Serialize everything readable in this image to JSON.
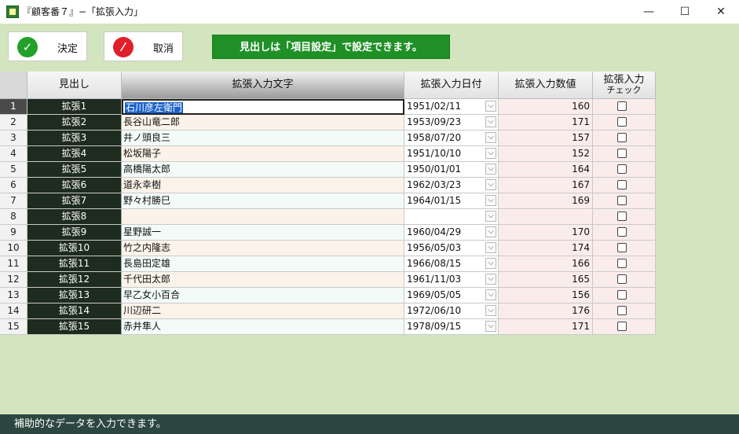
{
  "window": {
    "title": "『顧客番７』−「拡張入力」",
    "minimize_glyph": "—",
    "maximize_glyph": "☐",
    "close_glyph": "✕",
    "app_icon": "customer-app-icon"
  },
  "toolbar": {
    "ok_label": "決定",
    "ok_icon": "check-icon",
    "ok_color": "#21a12a",
    "cancel_label": "取消",
    "cancel_icon": "no-entry-icon",
    "cancel_color": "#e0202a",
    "banner_text": "見出しは「項目設定」で設定できます。",
    "banner_color": "#1f9026"
  },
  "grid": {
    "headers": {
      "label": "見出し",
      "text": "拡張入力文字",
      "date": "拡張入力日付",
      "number": "拡張入力数値",
      "check_line1": "拡張入力",
      "check_line2": "チェック"
    },
    "selected_row": 1,
    "rows": [
      {
        "no": "1",
        "label": "拡張1",
        "text": "石川彦左衛門",
        "date": "1951/02/11",
        "number": "160",
        "checked": false
      },
      {
        "no": "2",
        "label": "拡張2",
        "text": "長谷山竜二郎",
        "date": "1953/09/23",
        "number": "171",
        "checked": false
      },
      {
        "no": "3",
        "label": "拡張3",
        "text": "井ノ頭良三",
        "date": "1958/07/20",
        "number": "157",
        "checked": false
      },
      {
        "no": "4",
        "label": "拡張4",
        "text": "松坂陽子",
        "date": "1951/10/10",
        "number": "152",
        "checked": false
      },
      {
        "no": "5",
        "label": "拡張5",
        "text": "高橋陽太郎",
        "date": "1950/01/01",
        "number": "164",
        "checked": false
      },
      {
        "no": "6",
        "label": "拡張6",
        "text": "道永幸樹",
        "date": "1962/03/23",
        "number": "167",
        "checked": false
      },
      {
        "no": "7",
        "label": "拡張7",
        "text": "野々村勝巳",
        "date": "1964/01/15",
        "number": "169",
        "checked": false
      },
      {
        "no": "8",
        "label": "拡張8",
        "text": "",
        "date": "",
        "number": "",
        "checked": false
      },
      {
        "no": "9",
        "label": "拡張9",
        "text": "星野誠一",
        "date": "1960/04/29",
        "number": "170",
        "checked": false
      },
      {
        "no": "10",
        "label": "拡張10",
        "text": "竹之内隆志",
        "date": "1956/05/03",
        "number": "174",
        "checked": false
      },
      {
        "no": "11",
        "label": "拡張11",
        "text": "長島田定雄",
        "date": "1966/08/15",
        "number": "166",
        "checked": false
      },
      {
        "no": "12",
        "label": "拡張12",
        "text": "千代田太郎",
        "date": "1961/11/03",
        "number": "165",
        "checked": false
      },
      {
        "no": "13",
        "label": "拡張13",
        "text": "早乙女小百合",
        "date": "1969/05/05",
        "number": "156",
        "checked": false
      },
      {
        "no": "14",
        "label": "拡張14",
        "text": "川辺研二",
        "date": "1972/06/10",
        "number": "176",
        "checked": false
      },
      {
        "no": "15",
        "label": "拡張15",
        "text": "赤井隼人",
        "date": "1978/09/15",
        "number": "171",
        "checked": false
      }
    ]
  },
  "status": {
    "text": "補助的なデータを入力できます。"
  }
}
